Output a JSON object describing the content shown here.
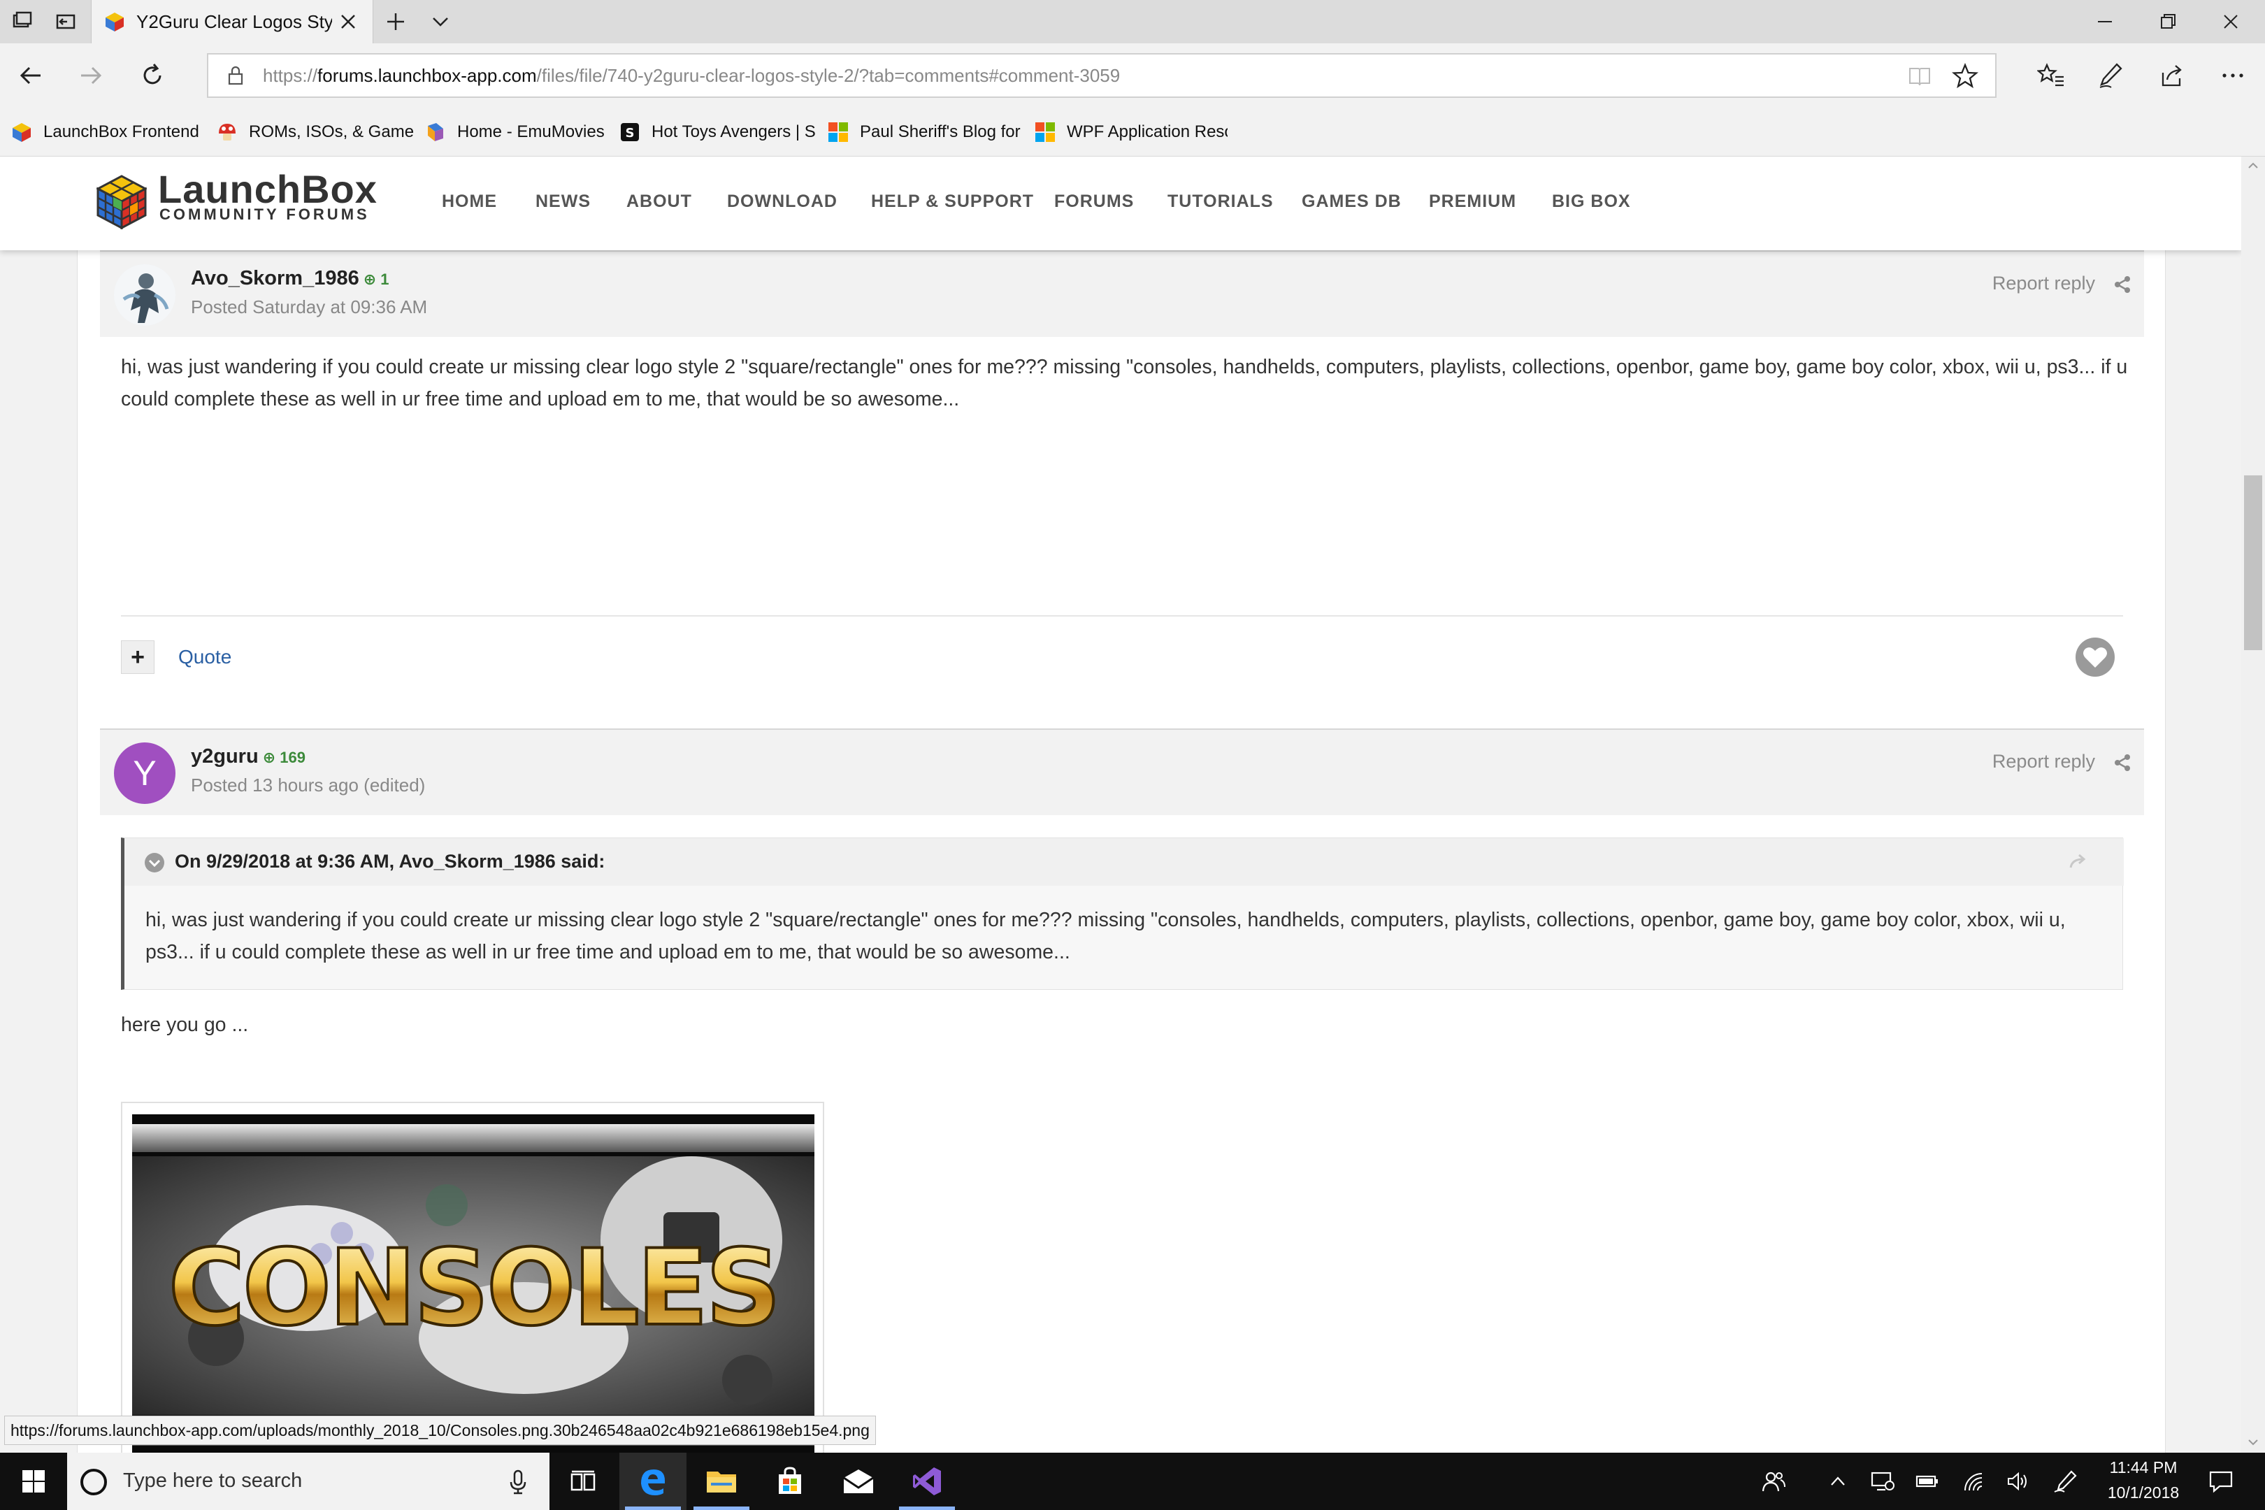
{
  "browser": {
    "tab_title": "Y2Guru Clear Logos Styl",
    "url_prefix": "https://",
    "url_domain": "forums.launchbox-app.com",
    "url_path": "/files/file/740-y2guru-clear-logos-style-2/?tab=comments#comment-3059",
    "favorites": [
      {
        "label": "LaunchBox Frontend"
      },
      {
        "label": "ROMs, ISOs, & Game"
      },
      {
        "label": "Home - EmuMovies"
      },
      {
        "label": "Hot Toys Avengers | S"
      },
      {
        "label": "Paul Sheriff's Blog for"
      },
      {
        "label": "WPF Application Reso"
      }
    ],
    "status_url": "https://forums.launchbox-app.com/uploads/monthly_2018_10/Consoles.png.30b246548aa02c4b921e686198eb15e4.png"
  },
  "site": {
    "logo_title": "LaunchBox",
    "logo_subtitle": "COMMUNITY FORUMS",
    "nav": [
      "HOME",
      "NEWS",
      "ABOUT",
      "DOWNLOAD",
      "HELP & SUPPORT",
      "FORUMS",
      "TUTORIALS",
      "GAMES DB",
      "PREMIUM",
      "BIG BOX"
    ]
  },
  "posts": [
    {
      "author": "Avo_Skorm_1986",
      "reputation": "1",
      "posted": "Posted Saturday at 09:36 AM",
      "report": "Report reply",
      "body": "hi, was just wandering if you could create ur missing clear logo style 2 \"square/rectangle\"  ones for me??? missing \"consoles, handhelds, computers, playlists, collections, openbor, game boy, game boy color, xbox, wii u, ps3... if u could complete these as well in ur free time and upload em to me, that would be so awesome...",
      "quote_label": "Quote",
      "plus_label": "+"
    },
    {
      "author": "y2guru",
      "avatar_letter": "Y",
      "reputation": "169",
      "posted": "Posted 13 hours ago (edited)",
      "report": "Report reply",
      "quote_cite": "On 9/29/2018 at 9:36 AM, Avo_Skorm_1986 said:",
      "quote_body": "hi, was just wandering if you could create ur missing clear logo style 2 \"square/rectangle\"  ones for me??? missing \"consoles, handhelds, computers, playlists, collections, openbor, game boy, game boy color, xbox, wii u, ps3... if u could complete these as well in ur free time and upload em to me, that would be so awesome...",
      "reply_text": "here you go ...",
      "image_text": "CONSOLES"
    }
  ],
  "taskbar": {
    "search_placeholder": "Type here to search",
    "time": "11:44 PM",
    "date": "10/1/2018"
  },
  "colors": {
    "accent_link": "#2a5fa3",
    "reputation_green": "#3c8a3a",
    "avatar_purple": "#a04fc0",
    "taskbar_bg": "#101010"
  }
}
